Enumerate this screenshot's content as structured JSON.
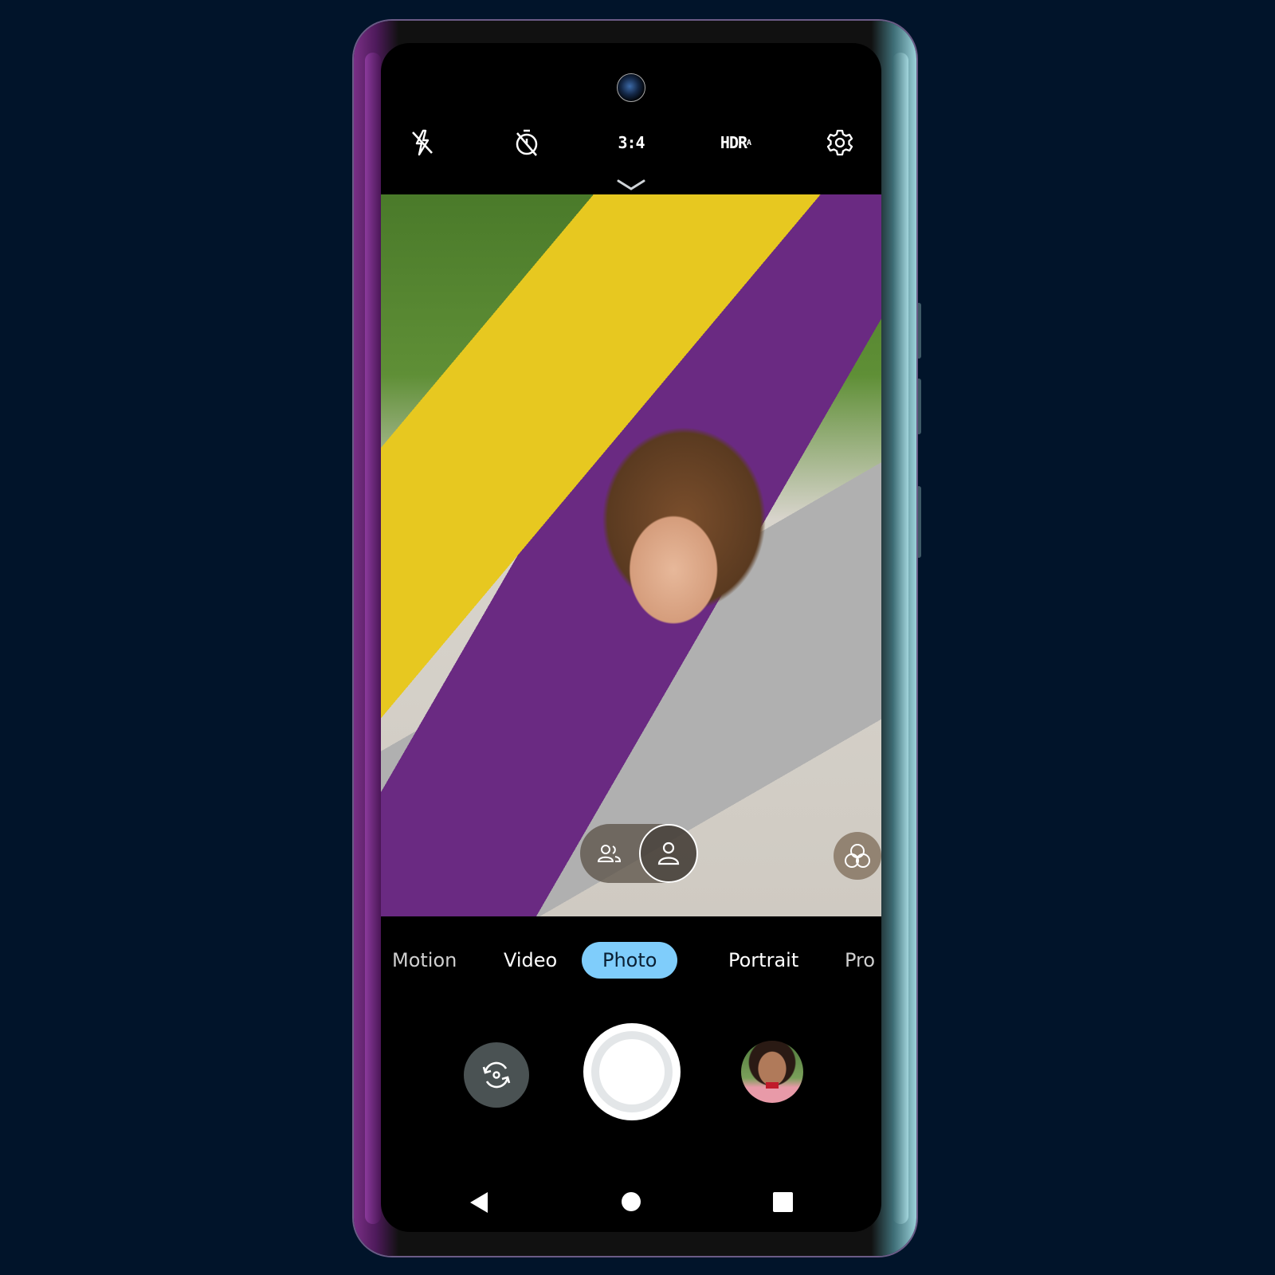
{
  "top_bar": {
    "flash": {
      "icon": "flash-off-icon",
      "label": "Flash off"
    },
    "timer": {
      "icon": "timer-off-icon",
      "label": "Timer off"
    },
    "aspect_ratio": "3:4",
    "hdr": {
      "label": "HDR",
      "mode": "A"
    },
    "settings": {
      "icon": "gear-icon",
      "label": "Settings"
    }
  },
  "expand": {
    "icon": "chevron-down-icon"
  },
  "viewfinder": {
    "people_toggle": {
      "options": [
        {
          "icon": "group-icon",
          "label": "Group",
          "active": false
        },
        {
          "icon": "person-icon",
          "label": "Single",
          "active": true
        }
      ]
    },
    "filters": {
      "icon": "filters-icon",
      "label": "Filters"
    }
  },
  "modes": [
    {
      "label": "Motion",
      "active": false
    },
    {
      "label": "Video",
      "active": false
    },
    {
      "label": "Photo",
      "active": true
    },
    {
      "label": "Portrait",
      "active": false
    },
    {
      "label": "Pro",
      "active": false
    }
  ],
  "controls": {
    "switch_camera": {
      "icon": "switch-camera-icon",
      "label": "Switch camera"
    },
    "shutter": {
      "label": "Shutter"
    },
    "gallery": {
      "label": "Last photo thumbnail"
    }
  },
  "nav": {
    "back": {
      "icon": "back-icon"
    },
    "home": {
      "icon": "home-icon"
    },
    "recents": {
      "icon": "recents-icon"
    }
  },
  "colors": {
    "accent": "#7fcdfb",
    "background": "#01142a",
    "switch_camera_bg": "#4a5253"
  }
}
